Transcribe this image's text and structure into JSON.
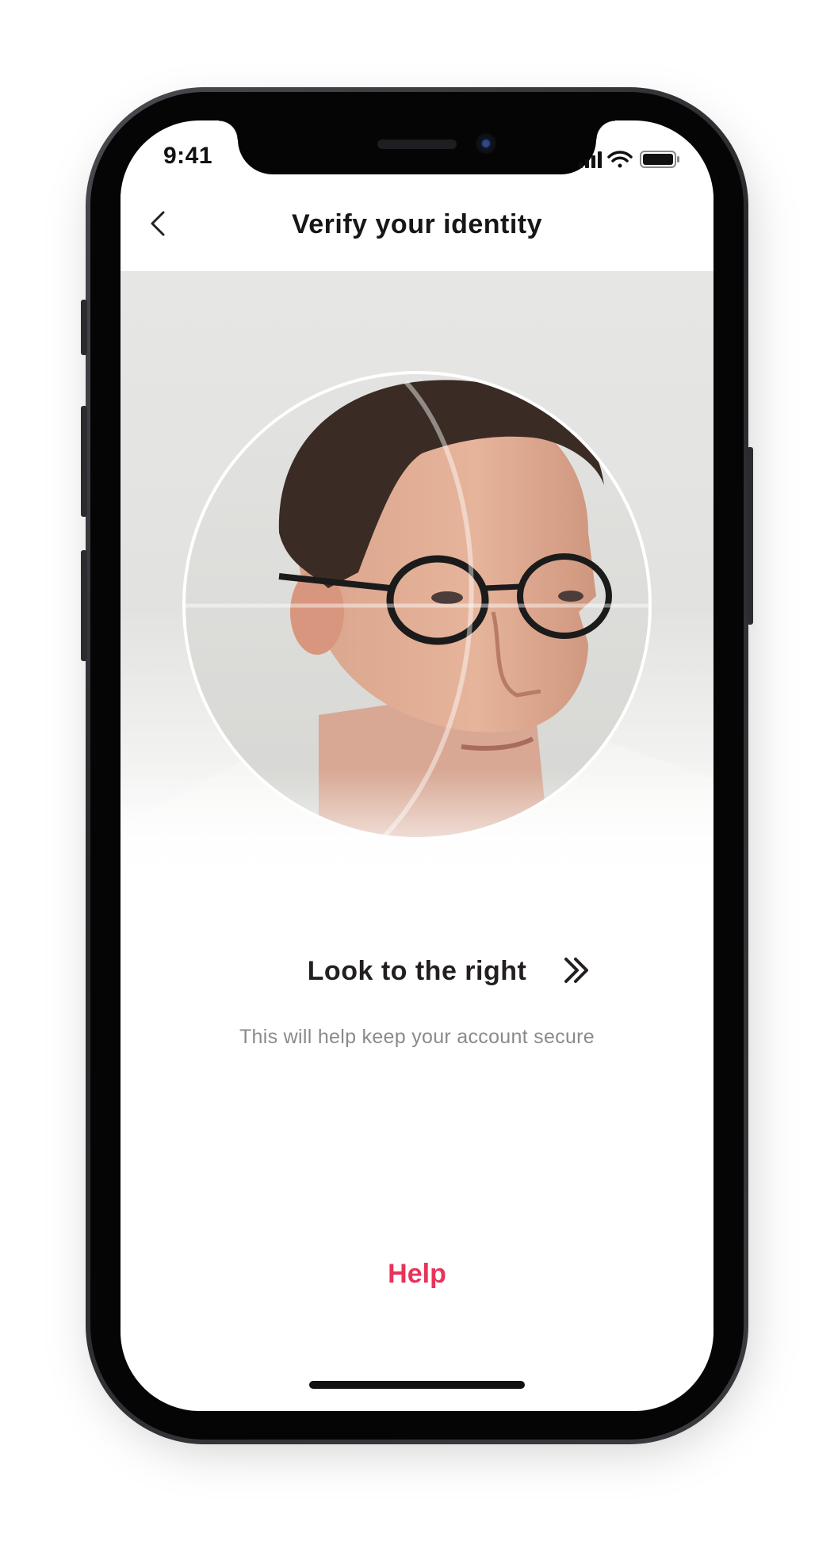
{
  "status_bar": {
    "time": "9:41",
    "icons": [
      "cellular-signal-icon",
      "wifi-icon",
      "battery-icon"
    ]
  },
  "nav": {
    "back_icon": "chevron-left-icon",
    "title": "Verify your identity"
  },
  "camera": {
    "overlay": "face-capture-circle"
  },
  "instruction": {
    "text": "Look to the right",
    "icon": "double-chevron-right-icon"
  },
  "subtext": "This will help keep your account secure",
  "help_label": "Help",
  "colors": {
    "accent": "#e8335b",
    "title": "#161616",
    "subtext": "#8a8a8a",
    "device_frame": "#2a2a2e"
  }
}
